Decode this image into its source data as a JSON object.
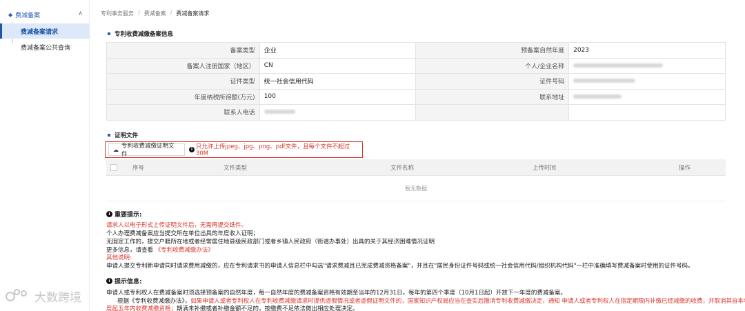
{
  "sidebar": {
    "group_label": "费减备案",
    "items": [
      {
        "label": "费减备案请求"
      },
      {
        "label": "费减备案公共查询"
      }
    ]
  },
  "breadcrumb": [
    "专利事务服务",
    "费减备案",
    "费减备案请求"
  ],
  "section1_title": "专利收费减缴备案信息",
  "info": {
    "rows": [
      {
        "l1": "备案类型",
        "v1": "企业",
        "l2": "预备案自然年度",
        "v2": "2023"
      },
      {
        "l1": "备案人注册国家（地区）",
        "v1": "CN",
        "l2": "个人/企业名称",
        "v2": ""
      },
      {
        "l1": "证件类型",
        "v1": "统一社会信用代码",
        "l2": "证件号码",
        "v2": ""
      },
      {
        "l1": "年度纳税所得额(万元)",
        "v1": "100",
        "l2": "联系地址",
        "v2": ""
      },
      {
        "l1": "联系人电话",
        "v1": "",
        "l2": "",
        "v2": ""
      }
    ]
  },
  "section2_title": "证明文件",
  "upload": {
    "button_label": "专利收费减缴证明文件",
    "hint": "只允许上传jpeg、jpg、png、pdf文件，且每个文件不超过30M"
  },
  "file_table": {
    "columns": [
      "序号",
      "文件类型",
      "文件名称",
      "上传时间",
      "操作"
    ],
    "empty_text": "暂无数据"
  },
  "important": {
    "title": "重要提示:",
    "line1": "请求人以电子形式上传证明文件后，无需再提交纸件。",
    "line2": "个人办理费减备案应当提交所在单位出具的年度收入证明；",
    "line3": "无固定工作的，提交户籍所在地或者经常居住地县级民政部门或者乡镇人民政府（街道办事处）出具的关于其经济困难情况证明",
    "line4_prefix": "更多信息，请查看",
    "line4_link": "《专利收费减缴办法》",
    "other_label": "其他说明:",
    "line5": "申请人提交专利新申请同时请求费用减缴的，应在专利请求书的申请人信息栏中勾选\"请求费减且已完成费减资格备案\"，并且在\"居民身份证件号码或统一社会信用代码/组织机构代码\"一栏中准确填写费减备案时使用的证件号码。"
  },
  "tips": {
    "title": "提示信息:",
    "line1": "申请人或专利权人在费减备案时须选择预备案的自然年度，每一自然年度的费减备案资格有效期至当年的12月31日。每年的第四个季度（10月1日起）开放下一年度的费减备案。",
    "line2_a": "根据《专利收费减缴办法》，",
    "line2_b": "如果申请人或者专利权人在专利收费减缴请求时提供虚假情况或者虚假证明文件的，国家知识产权局应当在查实后撤消专利收费减缴决定，通知 申请人或者专利权人在指定期限内补缴已经减缴的收费，并取消其自本年",
    "line3_a": "度起五年内收费减缴资格；",
    "line3_b": "期满未补缴或者补缴金额不足的，按缴费不足依法做出相应处理决定。"
  },
  "watermark": "大数跨境",
  "colors": {
    "accent": "#2a5fb0",
    "warning": "#d9352b",
    "active_bg": "#dde8f8"
  }
}
